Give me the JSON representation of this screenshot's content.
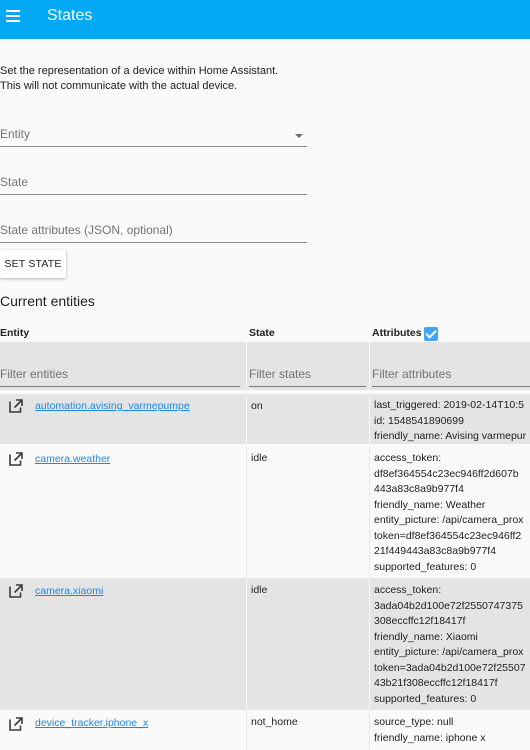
{
  "header": {
    "title": "States",
    "menu_icon": "menu-icon"
  },
  "intro": {
    "line1": "Set the representation of a device within Home Assistant.",
    "line2": "This will not communicate with the actual device."
  },
  "form": {
    "entity_label": "Entity",
    "state_label": "State",
    "attributes_label": "State attributes (JSON, optional)",
    "set_state_button": "SET STATE"
  },
  "entities_section": {
    "title": "Current entities",
    "columns": {
      "entity": "Entity",
      "state": "State",
      "attributes": "Attributes"
    },
    "attributes_checked": true,
    "filters": {
      "entity_placeholder": "Filter entities",
      "state_placeholder": "Filter states",
      "attributes_placeholder": "Filter attributes"
    },
    "rows": [
      {
        "entity_id": "automation.avising_varmepumpe",
        "state": "on",
        "attributes": [
          "last_triggered: 2019-02-14T10:5",
          "id: 1548541890699",
          "friendly_name: Avising varmepur"
        ]
      },
      {
        "entity_id": "camera.weather",
        "state": "idle",
        "attributes": [
          "access_token:",
          "df8ef364554c23ec946ff2d607b",
          "443a83c8a9b977f4",
          "friendly_name: Weather",
          "entity_picture: /api/camera_prox",
          "token=df8ef364554c23ec946ff2",
          "21f449443a83c8a9b977f4",
          "supported_features: 0"
        ]
      },
      {
        "entity_id": "camera.xiaomi",
        "state": "idle",
        "attributes": [
          "access_token:",
          "3ada04b2d100e72f2550747375",
          "308eccffc12f18417f",
          "friendly_name: Xiaomi",
          "entity_picture: /api/camera_prox",
          "token=3ada04b2d100e72f25507",
          "43b21f308eccffc12f18417f",
          "supported_features: 0"
        ]
      },
      {
        "entity_id": "device_tracker.iphone_x",
        "state": "not_home",
        "attributes": [
          "source_type: null",
          "friendly_name: iphone x"
        ]
      }
    ]
  },
  "colors": {
    "header": "#03a9f4",
    "link": "#1e88e5",
    "checkbox": "#42a5f5",
    "row_shade": "#e4e4e4"
  }
}
